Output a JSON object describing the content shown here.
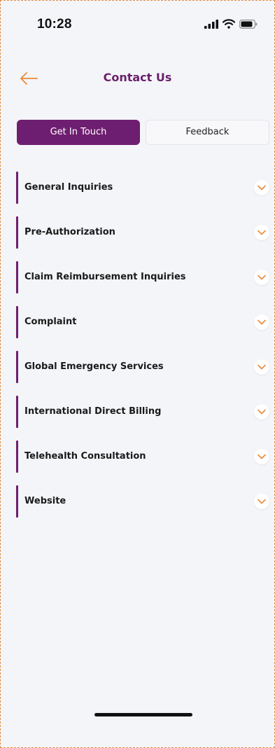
{
  "status_bar": {
    "time": "10:28",
    "signal_icon": "cellular-signal-icon",
    "wifi_icon": "wifi-icon",
    "battery_icon": "battery-icon"
  },
  "header": {
    "back_icon": "arrow-left-icon",
    "title": "Contact Us"
  },
  "tabs": [
    {
      "label": "Get In Touch",
      "active": true
    },
    {
      "label": "Feedback",
      "active": false
    }
  ],
  "sections": [
    {
      "label": "General Inquiries"
    },
    {
      "label": "Pre-Authorization"
    },
    {
      "label": "Claim Reimbursement Inquiries"
    },
    {
      "label": "Complaint"
    },
    {
      "label": "Global Emergency Services"
    },
    {
      "label": "International Direct Billing"
    },
    {
      "label": "Telehealth Consultation"
    },
    {
      "label": "Website"
    }
  ],
  "colors": {
    "brand": "#6e1e70",
    "accent": "#e8893a",
    "background": "#f4f5f9"
  }
}
